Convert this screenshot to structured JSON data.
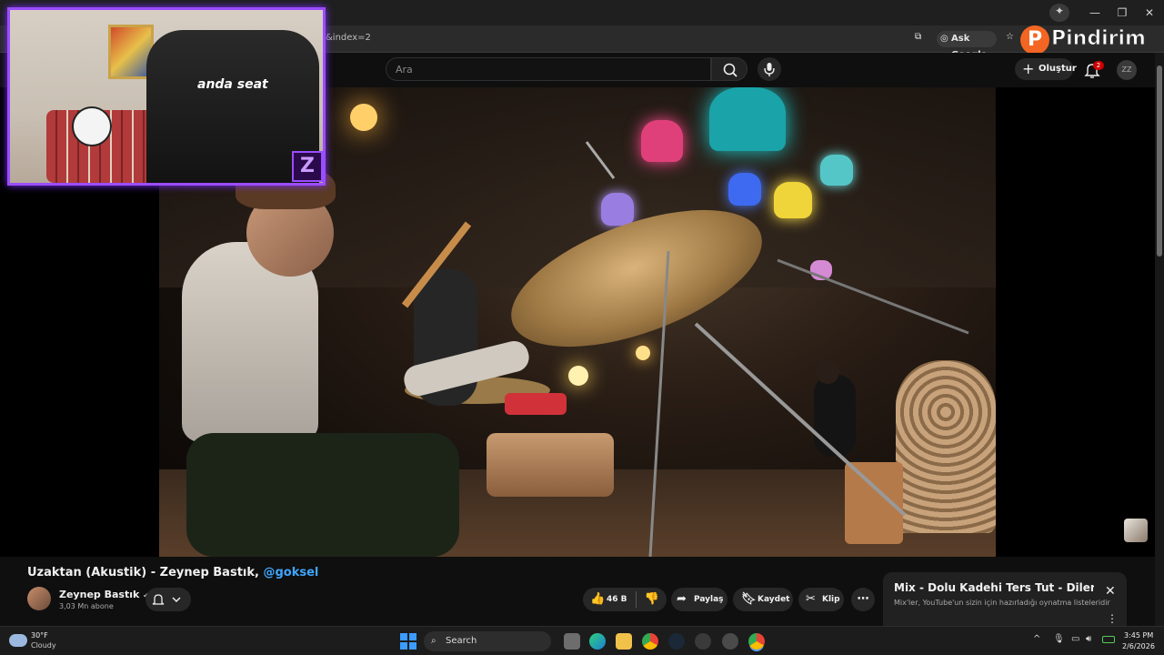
{
  "browser": {
    "url_fragment": "&index=2",
    "ask_google_label": "Ask Google",
    "watermark": "Pindirim"
  },
  "youtube_header": {
    "search_placeholder": "Ara",
    "create_label": "Oluştur",
    "notification_count": "2"
  },
  "video": {
    "title": "Uzaktan (Akustik) - Zeynep Bastık,",
    "title_mention": "@goksel"
  },
  "channel": {
    "name": "Zeynep Bastık",
    "subscribers": "3,03 Mn abone"
  },
  "actions": {
    "like_count": "46 B",
    "share_label": "Paylaş",
    "save_label": "Kaydet",
    "clip_label": "Klip"
  },
  "mix": {
    "title": "Mix - Dolu Kadehi Ters Tut - Dilerim...",
    "subtitle": "Mix'ler, YouTube'un sizin için hazırladığı oynatma listeleridir"
  },
  "webcam": {
    "chair_brand": "anda seat"
  },
  "taskbar": {
    "temperature": "30°F",
    "weather": "Cloudy",
    "search_label": "Search",
    "time": "3:45 PM",
    "date": "2/6/2026"
  },
  "colors": {
    "accent_purple": "#9b4dff",
    "link_blue": "#3ea6ff",
    "badge_red": "#cc0000",
    "watermark_orange": "#f26522"
  }
}
